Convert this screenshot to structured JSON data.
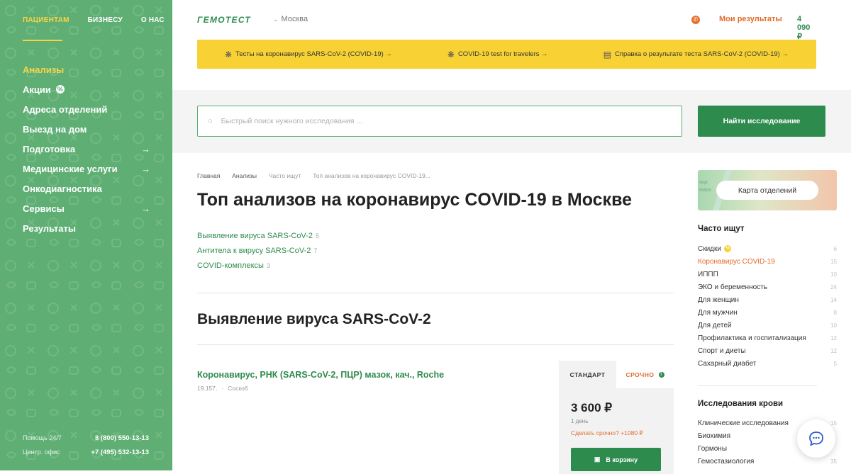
{
  "nav": {
    "top": [
      "ПАЦИЕНТАМ",
      "БИЗНЕСУ",
      "О НАС"
    ],
    "menu": [
      {
        "label": "Анализы"
      },
      {
        "label": "Акции"
      },
      {
        "label": "Адреса отделений"
      },
      {
        "label": "Выезд на дом"
      },
      {
        "label": "Подготовка",
        "arrow": "→"
      },
      {
        "label": "Медицинские услуги",
        "arrow": "→"
      },
      {
        "label": "Онкодиагностика"
      },
      {
        "label": "Сервисы",
        "arrow": "→"
      },
      {
        "label": "Результаты"
      }
    ],
    "promo_badge": "%",
    "contacts": [
      {
        "label": "Помощь 24/7",
        "number": "8 (800) 550-13-13"
      },
      {
        "label": "Центр. офис",
        "number": "+7 (495) 532-13-13"
      }
    ]
  },
  "header": {
    "logo": "ГЕМОТЕСТ",
    "city": "Москва",
    "my_results": "Мои результаты",
    "cart_total": "4 090 ₽"
  },
  "banner": {
    "items": [
      {
        "label": "Тесты на коронавирус SARS-CoV-2 (COVID-19) →"
      },
      {
        "label": "COVID-19 test for travelers →"
      },
      {
        "label": "Справка о результате теста SARS-CoV-2 (COVID-19) →"
      }
    ]
  },
  "search": {
    "placeholder": "Быстрый поиск нужного исследования ...",
    "button": "Найти исследование"
  },
  "breadcrumb": [
    "Главная",
    "Анализы",
    "Часто ищут",
    "Топ анализов на коронавирус COVID-19..."
  ],
  "page_title": "Топ анализов на коронавирус COVID-19 в Москве",
  "categories": [
    {
      "label": "Выявление вируса SARS-CoV-2",
      "count": "5"
    },
    {
      "label": "Антитела к вирусу SARS-CoV-2",
      "count": "7"
    },
    {
      "label": "COVID-комплексы",
      "count": "3"
    }
  ],
  "section_title": "Выявление вируса SARS-CoV-2",
  "product": {
    "name": "Коронавирус, РНК (SARS-CoV-2, ПЦР) мазок, кач., Roche",
    "code": "19.157.",
    "material": "Соскоб",
    "tab_standard": "СТАНДАРТ",
    "tab_urgent": "СРОЧНО",
    "price": "3 600 ₽",
    "duration": "1 день",
    "urgent_offer": "Сделать срочно? +1080 ₽",
    "add_to_cart": "В корзину"
  },
  "sidebar_right": {
    "map_button": "Карта отделений",
    "map_text_1": "ица",
    "map_text_2": "мира",
    "popular_title": "Часто ищут",
    "popular": [
      {
        "label": "Скидки",
        "count": "6"
      },
      {
        "label": "Коронавирус COVID-19",
        "count": "15"
      },
      {
        "label": "ИППП",
        "count": "10"
      },
      {
        "label": "ЭКО и беременность",
        "count": "24"
      },
      {
        "label": "Для женщин",
        "count": "14"
      },
      {
        "label": "Для мужчин",
        "count": "8"
      },
      {
        "label": "Для детей",
        "count": "10"
      },
      {
        "label": "Профилактика и госпитализация",
        "count": "12"
      },
      {
        "label": "Спорт и диеты",
        "count": "12"
      },
      {
        "label": "Сахарный диабет",
        "count": "5"
      }
    ],
    "blood_title": "Исследования крови",
    "blood": [
      {
        "label": "Клинические исследования",
        "count": "15"
      },
      {
        "label": "Биохимия",
        "count": ""
      },
      {
        "label": "Гормоны",
        "count": ""
      },
      {
        "label": "Гемостазиология",
        "count": "35"
      }
    ]
  },
  "colors": {
    "sidebar": "#5faf74",
    "accent_green": "#2e8b4e",
    "accent_orange": "#e06c2c",
    "banner_yellow": "#f8d234"
  }
}
